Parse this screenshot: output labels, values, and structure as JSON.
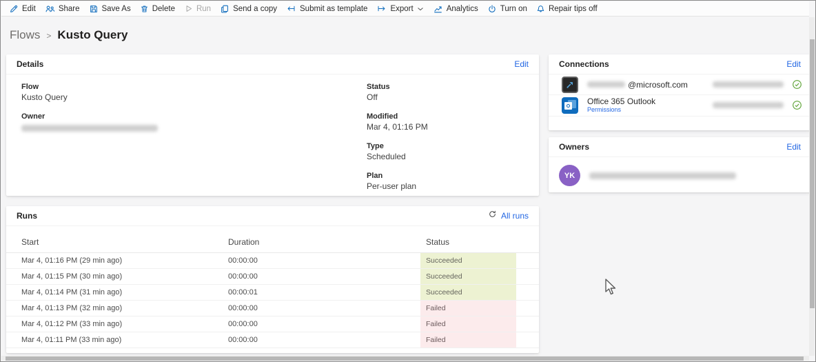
{
  "toolbar": {
    "items": [
      {
        "label": "Edit",
        "icon": "pencil-icon",
        "disabled": false
      },
      {
        "label": "Share",
        "icon": "people-icon",
        "disabled": false
      },
      {
        "label": "Save As",
        "icon": "save-icon",
        "disabled": false
      },
      {
        "label": "Delete",
        "icon": "trash-icon",
        "disabled": false
      },
      {
        "label": "Run",
        "icon": "play-icon",
        "disabled": true
      },
      {
        "label": "Send a copy",
        "icon": "copy-icon",
        "disabled": false
      },
      {
        "label": "Submit as template",
        "icon": "arrow-from-bar-left-icon",
        "disabled": false
      },
      {
        "label": "Export",
        "icon": "arrow-from-bar-right-icon",
        "has_chevron": true,
        "disabled": false
      },
      {
        "label": "Analytics",
        "icon": "line-chart-icon",
        "disabled": false
      },
      {
        "label": "Turn on",
        "icon": "power-icon",
        "disabled": false
      },
      {
        "label": "Repair tips off",
        "icon": "bell-icon",
        "disabled": false
      }
    ]
  },
  "breadcrumb": {
    "root": "Flows",
    "separator": ">",
    "current": "Kusto Query"
  },
  "details": {
    "title": "Details",
    "edit_label": "Edit",
    "fields_left": [
      {
        "label": "Flow",
        "value": "Kusto Query"
      },
      {
        "label": "Owner",
        "value_redacted": true
      }
    ],
    "fields_right": [
      {
        "label": "Status",
        "value": "Off"
      },
      {
        "label": "Modified",
        "value": "Mar 4, 01:16 PM"
      },
      {
        "label": "Type",
        "value": "Scheduled"
      },
      {
        "label": "Plan",
        "value": "Per-user plan"
      }
    ]
  },
  "connections": {
    "title": "Connections",
    "edit_label": "Edit",
    "rows": [
      {
        "icon": "kusto-connector-icon",
        "name_redacted": true,
        "name_suffix": "@microsoft.com",
        "account_redacted": true,
        "status_icon": "check-circle-icon"
      },
      {
        "icon": "office365-outlook-icon",
        "name": "Office 365 Outlook",
        "link": "Permissions",
        "account_redacted": true,
        "status_icon": "check-circle-icon"
      }
    ]
  },
  "owners": {
    "title": "Owners",
    "edit_label": "Edit",
    "avatar_initials": "YK",
    "name_redacted": true
  },
  "runs": {
    "title": "Runs",
    "all_runs_label": "All runs",
    "refresh_icon": "refresh-icon",
    "columns": [
      "Start",
      "Duration",
      "Status"
    ],
    "rows": [
      {
        "start": "Mar 4, 01:16 PM (29 min ago)",
        "duration": "00:00:00",
        "status": "Succeeded"
      },
      {
        "start": "Mar 4, 01:15 PM (30 min ago)",
        "duration": "00:00:00",
        "status": "Succeeded"
      },
      {
        "start": "Mar 4, 01:14 PM (31 min ago)",
        "duration": "00:00:01",
        "status": "Succeeded"
      },
      {
        "start": "Mar 4, 01:13 PM (32 min ago)",
        "duration": "00:00:00",
        "status": "Failed"
      },
      {
        "start": "Mar 4, 01:12 PM (33 min ago)",
        "duration": "00:00:00",
        "status": "Failed"
      },
      {
        "start": "Mar 4, 01:11 PM (33 min ago)",
        "duration": "00:00:00",
        "status": "Failed"
      }
    ]
  },
  "colors": {
    "link_blue": "#2266e3",
    "toolbar_icon_blue": "#0f6cbd",
    "succeeded_bg": "#edf2d2",
    "failed_bg": "#fcebec",
    "check_green": "#61a53a",
    "avatar_purple": "#8961c5"
  }
}
